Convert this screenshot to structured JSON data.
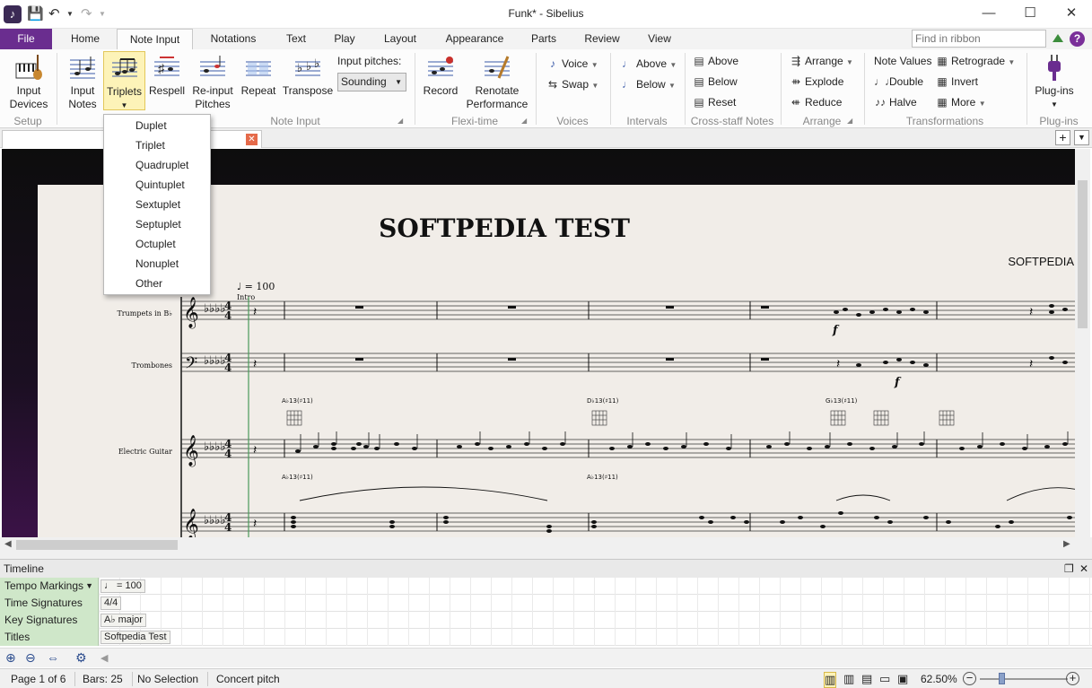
{
  "window": {
    "title": "Funk* - Sibelius",
    "minimize": "—",
    "maximize": "☐",
    "close": "✕"
  },
  "ribbon_tabs": [
    "File",
    "Home",
    "Note Input",
    "Notations",
    "Text",
    "Play",
    "Layout",
    "Appearance",
    "Parts",
    "Review",
    "View"
  ],
  "find_placeholder": "Find in ribbon",
  "help_label": "?",
  "groups": {
    "setup": "Setup",
    "note_input": "Note Input",
    "flexi_time": "Flexi-time",
    "voices": "Voices",
    "intervals": "Intervals",
    "cross_staff": "Cross-staff Notes",
    "arrange": "Arrange",
    "transformations": "Transformations",
    "plugins": "Plug-ins"
  },
  "buttons": {
    "input_devices": [
      "Input",
      "Devices"
    ],
    "input_notes": [
      "Input",
      "Notes"
    ],
    "triplets": "Triplets",
    "respell": "Respell",
    "reinput_pitches": [
      "Re-input",
      "Pitches"
    ],
    "repeat": "Repeat",
    "transpose": "Transpose",
    "input_pitches_label": "Input pitches:",
    "input_pitches_value": "Sounding",
    "record": "Record",
    "renotate_performance": [
      "Renotate",
      "Performance"
    ],
    "voice": "Voice",
    "swap": "Swap",
    "above": "Above",
    "below": "Below",
    "cs_above": "Above",
    "cs_below": "Below",
    "cs_reset": "Reset",
    "arrange": "Arrange",
    "explode": "Explode",
    "reduce": "Reduce",
    "note_values": "Note Values",
    "retrograde": "Retrograde",
    "double": "Double",
    "invert": "Invert",
    "halve": "Halve",
    "more": "More",
    "plugins": [
      "Plug-ins"
    ]
  },
  "triplets_menu": [
    "Duplet",
    "Triplet",
    "Quadruplet",
    "Quintuplet",
    "Sextuplet",
    "Septuplet",
    "Octuplet",
    "Nonuplet",
    "Other"
  ],
  "score": {
    "title": "SOFTPEDIA TEST",
    "composer": "SOFTPEDIA",
    "tempo": "♩ = 100",
    "rehearsal": "Intro",
    "instruments": [
      "Trumpets in B♭",
      "Trombones",
      "Electric Guitar"
    ],
    "chords": [
      "A♭13(♯11)",
      "D♭13(♯11)",
      "G♭13(♯11)",
      "A♭13(♯11)",
      "A♭13(♯11)"
    ],
    "dynamic": "f"
  },
  "timeline": {
    "title": "Timeline",
    "rows": [
      {
        "label": "Tempo Markings",
        "value": "♩ = 100"
      },
      {
        "label": "Time Signatures",
        "value": "4/4"
      },
      {
        "label": "Key Signatures",
        "value": "A♭ major"
      },
      {
        "label": "Titles",
        "value": "Softpedia Test"
      }
    ]
  },
  "status": {
    "page": "Page 1 of 6",
    "bars": "Bars: 25",
    "selection": "No Selection",
    "pitch": "Concert pitch",
    "zoom": "62.50%"
  },
  "colors": {
    "accent": "#6a2d8f",
    "selected_button": "#fdf3b8",
    "timeline_label": "#cfe7c9"
  }
}
